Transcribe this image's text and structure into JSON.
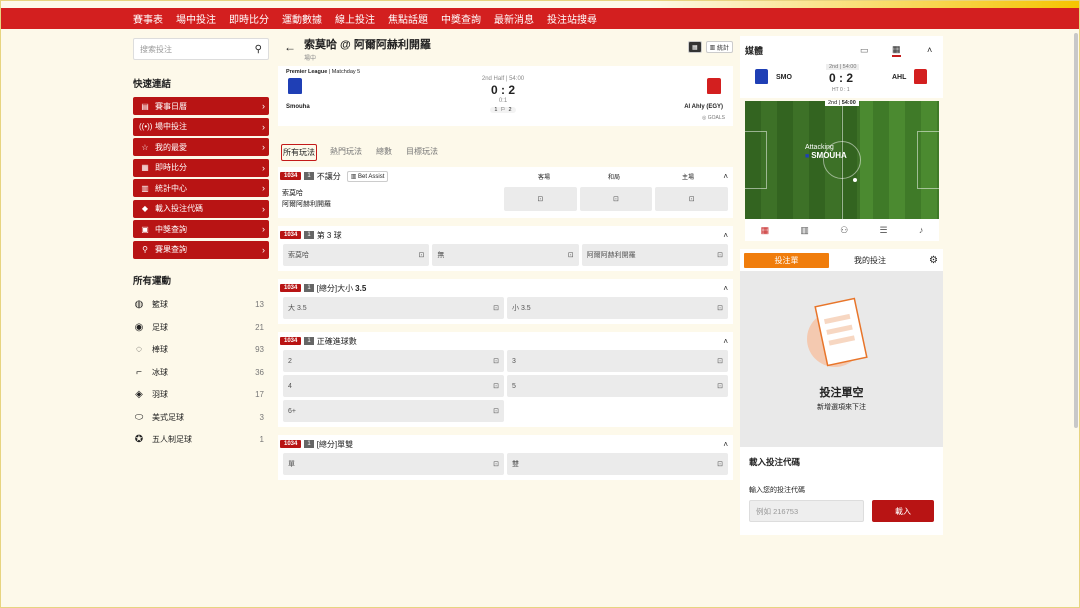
{
  "nav": [
    "賽事表",
    "場中投注",
    "即時比分",
    "運動數據",
    "線上投注",
    "焦點話題",
    "中獎查詢",
    "最新消息",
    "投注站搜尋"
  ],
  "left": {
    "search_placeholder": "搜索投注",
    "quick_title": "快速連結",
    "quick": [
      {
        "icon": "calendar-icon",
        "glyph": "▤",
        "label": "賽事日曆"
      },
      {
        "icon": "live-icon",
        "glyph": "((•))",
        "label": "場中投注"
      },
      {
        "icon": "star-icon",
        "glyph": "☆",
        "label": "我的最愛"
      },
      {
        "icon": "scoreboard-icon",
        "glyph": "▦",
        "label": "即時比分"
      },
      {
        "icon": "stats-icon",
        "glyph": "▥",
        "label": "統計中心"
      },
      {
        "icon": "tag-icon",
        "glyph": "◆",
        "label": "載入投注代碼"
      },
      {
        "icon": "receipt-icon",
        "glyph": "▣",
        "label": "中獎查詢"
      },
      {
        "icon": "search-icon",
        "glyph": "⚲",
        "label": "賽果查詢"
      }
    ],
    "sports_title": "所有運動",
    "sports": [
      {
        "icon": "basketball-icon",
        "glyph": "◍",
        "label": "籃球",
        "count": "13"
      },
      {
        "icon": "soccer-icon",
        "glyph": "◉",
        "label": "足球",
        "count": "21"
      },
      {
        "icon": "baseball-icon",
        "glyph": "◌",
        "label": "棒球",
        "count": "93"
      },
      {
        "icon": "hockey-icon",
        "glyph": "⌐",
        "label": "冰球",
        "count": "36"
      },
      {
        "icon": "badminton-icon",
        "glyph": "◈",
        "label": "羽球",
        "count": "17"
      },
      {
        "icon": "american-football-icon",
        "glyph": "⬭",
        "label": "美式足球",
        "count": "3"
      },
      {
        "icon": "futsal-icon",
        "glyph": "✪",
        "label": "五人制足球",
        "count": "1"
      }
    ]
  },
  "main": {
    "title": "索莫哈 @ 阿爾阿赫利開羅",
    "subtitle": "場中",
    "tool_stats": "統計",
    "league": "Premier League",
    "matchday": "Matchday 5",
    "period": "2nd Half | 54:00",
    "score": "0 : 2",
    "ht": "0:1",
    "home": "Smouha",
    "away": "Al Ahly (EGY)",
    "corners": "1",
    "corners2": "2",
    "goals": "GOALS",
    "tabs": [
      "所有玩法",
      "熱門玩法",
      "總數",
      "目標玩法"
    ],
    "markets": [
      {
        "id": "1034",
        "num": "1",
        "title": "不讓分",
        "assist": "Bet Assist",
        "cols": [
          "客場",
          "和局",
          "主場"
        ],
        "row_home": "索莫哈",
        "row_away": "阿爾阿赫利開羅"
      },
      {
        "id": "1034",
        "num": "1",
        "title": "第 3 球",
        "cells": [
          "索莫哈",
          "無",
          "阿爾阿赫利開羅"
        ]
      },
      {
        "id": "1034",
        "num": "1",
        "title": "[總分]大小",
        "title_val": "3.5",
        "cells": [
          "大 3.5",
          "小 3.5"
        ]
      },
      {
        "id": "1034",
        "num": "1",
        "title": "正確進球數",
        "cells": [
          "2",
          "3",
          "4",
          "5",
          "6+"
        ]
      },
      {
        "id": "1034",
        "num": "1",
        "title": "[總分]單雙",
        "cells": [
          "單",
          "雙"
        ]
      }
    ]
  },
  "right": {
    "media_title": "媒體",
    "home_abbr": "SMO",
    "away_abbr": "AHL",
    "period": "2nd | 54:00",
    "score": "0 : 2",
    "ht": "HT 0 : 1",
    "pitch_period": "2nd",
    "pitch_time": "54:00",
    "attacking": "Attacking",
    "attacking_team": "SMOUHA",
    "slip_tab": "投注單",
    "my_bets_tab": "我的投注",
    "empty_title": "投注單空",
    "empty_sub": "新增選項來下注",
    "code_title": "載入投注代碼",
    "code_label": "輸入您的投注代碼",
    "code_placeholder": "例如 216753",
    "code_button": "載入"
  },
  "colors": {
    "brand_red": "#d31f1f",
    "dark_red": "#b81414",
    "orange": "#f07d0c",
    "pitch": "#4b8a30"
  }
}
